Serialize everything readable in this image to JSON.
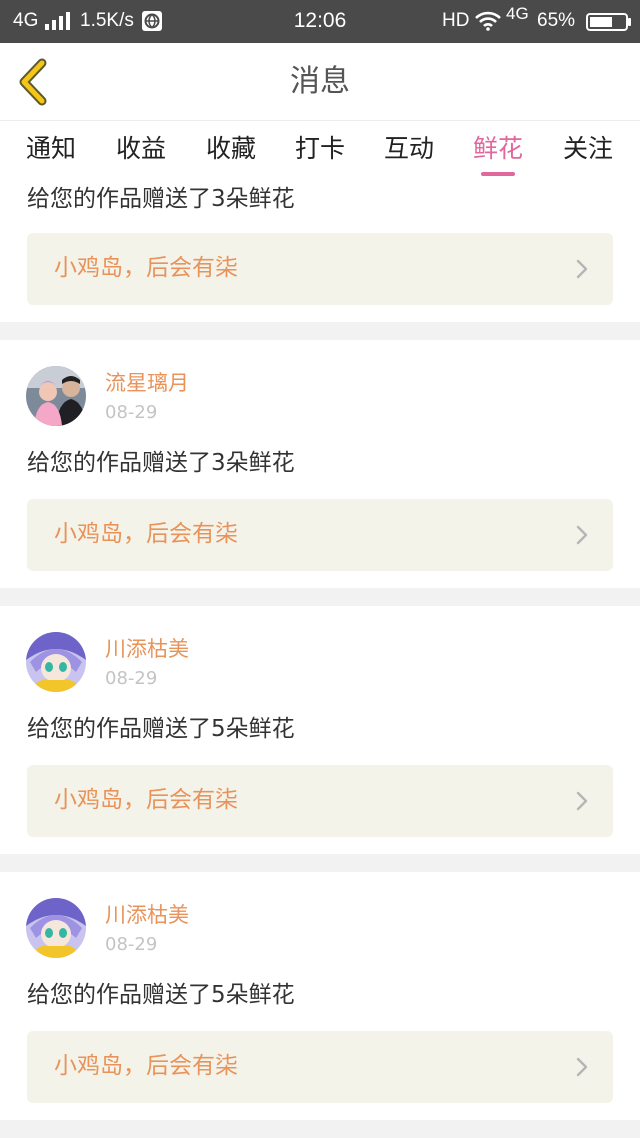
{
  "status_bar": {
    "network": "4G",
    "speed": "1.5K/s",
    "time": "12:06",
    "hd": "HD",
    "network2": "4G",
    "battery": "65%"
  },
  "header": {
    "title": "消息",
    "accent_color": "#f5c518"
  },
  "tabs": [
    {
      "label": "通知"
    },
    {
      "label": "收益"
    },
    {
      "label": "收藏"
    },
    {
      "label": "打卡"
    },
    {
      "label": "互动"
    },
    {
      "label": "鲜花",
      "active": true
    },
    {
      "label": "关注"
    }
  ],
  "colors": {
    "active_tab": "#e0689d",
    "name": "#e8935a",
    "link_bg": "#f4f3ea"
  },
  "messages": [
    {
      "text": "给您的作品赠送了3朵鲜花",
      "work_title": "小鸡岛，后会有柒"
    },
    {
      "user": "流星璃月",
      "date": "08-29",
      "avatar_icon": "avatar-photo-couple",
      "text": "给您的作品赠送了3朵鲜花",
      "work_title": "小鸡岛，后会有柒"
    },
    {
      "user": "川添枯美",
      "date": "08-29",
      "avatar_icon": "avatar-anime-girl",
      "text": "给您的作品赠送了5朵鲜花",
      "work_title": "小鸡岛，后会有柒"
    },
    {
      "user": "川添枯美",
      "date": "08-29",
      "avatar_icon": "avatar-anime-girl",
      "text": "给您的作品赠送了5朵鲜花",
      "work_title": "小鸡岛，后会有柒"
    }
  ]
}
